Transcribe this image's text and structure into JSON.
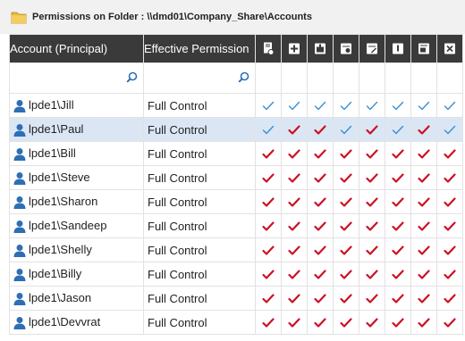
{
  "window": {
    "title": "Permissions on Folder : \\\\dmd01\\Company_Share\\Accounts",
    "icon": "folder-icon"
  },
  "columns": {
    "account": "Account (Principal)",
    "effective": "Effective Permission",
    "permission_icons": [
      "list-folder-icon",
      "create-files-icon",
      "create-folders-icon",
      "read-attributes-icon",
      "write-attributes-icon",
      "read-ext-attributes-icon",
      "write-ext-attributes-icon",
      "delete-icon"
    ]
  },
  "filters": {
    "account_placeholder": "",
    "effective_placeholder": ""
  },
  "colors": {
    "header_bg": "#3a3a3a",
    "selected_row": "#dbe6f5",
    "check_blue": "#3a8fd0",
    "check_red": "#cc1122",
    "user_icon": "#2d6fb5"
  },
  "rows": [
    {
      "account": "lpde1\\Jill",
      "effective": "Full Control",
      "checks": [
        "blue",
        "blue",
        "blue",
        "blue",
        "blue",
        "blue",
        "blue",
        "blue"
      ],
      "selected": false
    },
    {
      "account": "lpde1\\Paul",
      "effective": "Full Control",
      "checks": [
        "blue",
        "red",
        "red",
        "blue",
        "red",
        "blue",
        "red",
        "blue"
      ],
      "selected": true
    },
    {
      "account": "lpde1\\Bill",
      "effective": "Full Control",
      "checks": [
        "red",
        "red",
        "red",
        "red",
        "red",
        "red",
        "red",
        "red"
      ],
      "selected": false
    },
    {
      "account": "lpde1\\Steve",
      "effective": "Full Control",
      "checks": [
        "red",
        "red",
        "red",
        "red",
        "red",
        "red",
        "red",
        "red"
      ],
      "selected": false
    },
    {
      "account": "lpde1\\Sharon",
      "effective": "Full Control",
      "checks": [
        "red",
        "red",
        "red",
        "red",
        "red",
        "red",
        "red",
        "red"
      ],
      "selected": false
    },
    {
      "account": "lpde1\\Sandeep",
      "effective": "Full Control",
      "checks": [
        "red",
        "red",
        "red",
        "red",
        "red",
        "red",
        "red",
        "red"
      ],
      "selected": false
    },
    {
      "account": "lpde1\\Shelly",
      "effective": "Full Control",
      "checks": [
        "red",
        "red",
        "red",
        "red",
        "red",
        "red",
        "red",
        "red"
      ],
      "selected": false
    },
    {
      "account": "lpde1\\Billy",
      "effective": "Full Control",
      "checks": [
        "red",
        "red",
        "red",
        "red",
        "red",
        "red",
        "red",
        "red"
      ],
      "selected": false
    },
    {
      "account": "lpde1\\Jason",
      "effective": "Full Control",
      "checks": [
        "red",
        "red",
        "red",
        "red",
        "red",
        "red",
        "red",
        "red"
      ],
      "selected": false
    },
    {
      "account": "lpde1\\Devvrat",
      "effective": "Full Control",
      "checks": [
        "red",
        "red",
        "red",
        "red",
        "red",
        "red",
        "red",
        "red"
      ],
      "selected": false
    }
  ]
}
